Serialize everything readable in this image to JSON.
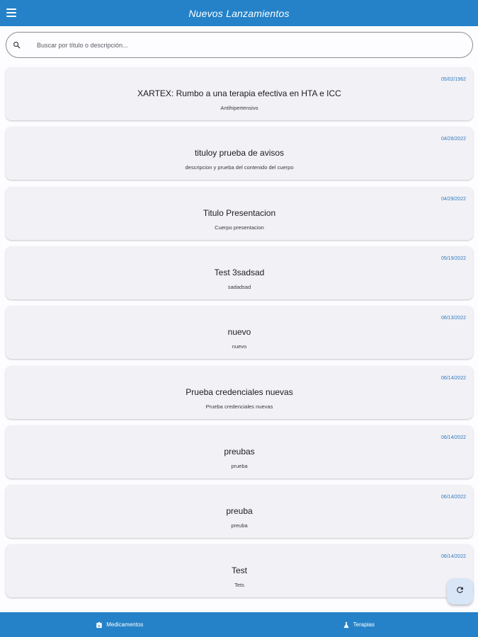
{
  "appbar": {
    "title": "Nuevos Lanzamientos",
    "menu_icon": "menu-icon"
  },
  "search": {
    "placeholder": "Buscar por título o descripción...",
    "value": "",
    "icon": "search-icon"
  },
  "items": [
    {
      "date": "05/02/1962",
      "title": "XARTEX: Rumbo a una terapia efectiva en HTA e ICC",
      "description": "Antihipertensivo"
    },
    {
      "date": "04/26/2022",
      "title": "tituloy prueba de avisos",
      "description": "descripcion y prueba del contenido del cuerpo"
    },
    {
      "date": "04/29/2022",
      "title": "Titulo Presentacion",
      "description": "Cuerpo presentacion"
    },
    {
      "date": "05/19/2022",
      "title": "Test 3sadsad",
      "description": "sadadsad"
    },
    {
      "date": "06/13/2022",
      "title": "nuevo",
      "description": "nuevo"
    },
    {
      "date": "06/14/2022",
      "title": "Prueba credenciales nuevas",
      "description": "Prueba credenciales nuevas"
    },
    {
      "date": "06/14/2022",
      "title": "preubas",
      "description": "prueba"
    },
    {
      "date": "06/14/2022",
      "title": "preuba",
      "description": "preuba"
    },
    {
      "date": "06/14/2022",
      "title": "Test",
      "description": "Tets"
    }
  ],
  "fab": {
    "icon": "refresh-icon"
  },
  "bottom_nav": {
    "items": [
      {
        "label": "Medicamentos",
        "icon": "medicine-bag-icon"
      },
      {
        "label": "Terapias",
        "icon": "flask-icon"
      }
    ]
  },
  "colors": {
    "primary": "#2582c8",
    "card_bg": "#f2f1f6",
    "date_text": "#2a7ac0",
    "fab_bg": "#d8e6f7"
  }
}
